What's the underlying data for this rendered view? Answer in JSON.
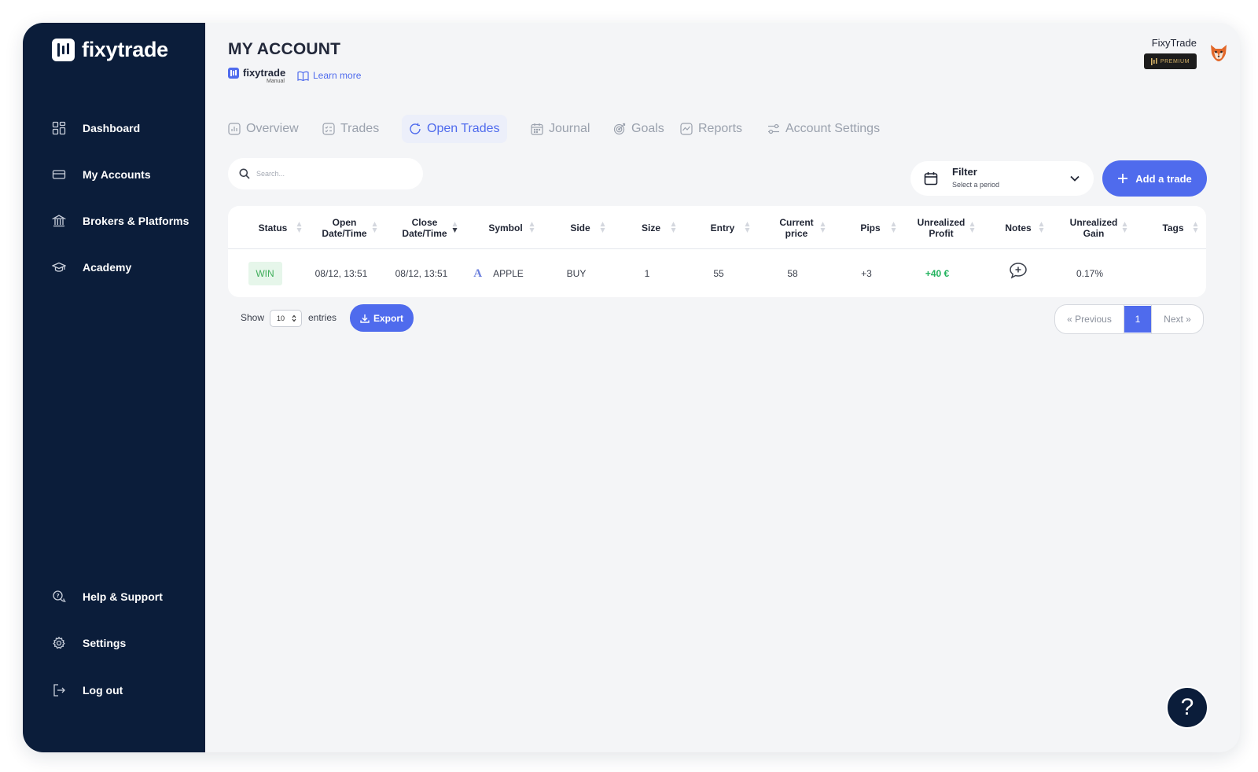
{
  "brand": {
    "name": "fixytrade"
  },
  "sidebar": {
    "items": [
      {
        "label": "Dashboard",
        "icon": "grid-icon"
      },
      {
        "label": "My Accounts",
        "icon": "card-icon"
      },
      {
        "label": "Brokers & Platforms",
        "icon": "bank-icon"
      },
      {
        "label": "Academy",
        "icon": "graduation-cap-icon"
      }
    ],
    "bottom_items": [
      {
        "label": "Help & Support",
        "icon": "help-chat-icon"
      },
      {
        "label": "Settings",
        "icon": "gear-icon"
      },
      {
        "label": "Log out",
        "icon": "logout-icon"
      }
    ]
  },
  "header": {
    "title": "MY ACCOUNT",
    "manual_brand": "fixytrade",
    "manual_sub": "Manual",
    "learn_more": "Learn more",
    "user_name": "FixyTrade",
    "premium_label": "PREMIUM"
  },
  "tabs": [
    {
      "label": "Overview",
      "icon": "bar-chart-icon"
    },
    {
      "label": "Trades",
      "icon": "list-check-icon"
    },
    {
      "label": "Open Trades",
      "icon": "refresh-icon",
      "active": true
    },
    {
      "label": "Journal",
      "icon": "calendar-icon"
    },
    {
      "label": "Goals",
      "icon": "target-icon"
    },
    {
      "label": "Reports",
      "icon": "report-icon"
    },
    {
      "label": "Account Settings",
      "icon": "sliders-icon"
    }
  ],
  "toolbar": {
    "search_placeholder": "Search...",
    "filter_title": "Filter",
    "filter_sub": "Select a period",
    "add_trade": "Add a trade"
  },
  "table": {
    "headers": {
      "status": "Status",
      "open_1": "Open",
      "open_2": "Date/Time",
      "close_1": "Close",
      "close_2": "Date/Time",
      "symbol": "Symbol",
      "side": "Side",
      "size": "Size",
      "entry": "Entry",
      "current_1": "Current",
      "current_2": "price",
      "pips": "Pips",
      "uprofit_1": "Unrealized",
      "uprofit_2": "Profit",
      "notes": "Notes",
      "ugain_1": "Unrealized",
      "ugain_2": "Gain",
      "tags": "Tags"
    },
    "rows": [
      {
        "status": "WIN",
        "open": "08/12, 13:51",
        "close": "08/12, 13:51",
        "symbol_logo": "A",
        "symbol": "APPLE",
        "side": "BUY",
        "size": "1",
        "entry": "55",
        "current": "58",
        "pips": "+3",
        "profit": "+40 €",
        "gain": "0.17%",
        "tags": ""
      }
    ]
  },
  "footer": {
    "show": "Show",
    "entries_value": "10",
    "entries": "entries",
    "export": "Export",
    "prev": "« Previous",
    "page": "1",
    "next": "Next »"
  },
  "help_fab": "?",
  "colors": {
    "sidebar_bg": "#0b1d3a",
    "accent": "#4f6bed",
    "win_bg": "#e6f6ea",
    "win_text": "#3fae5a",
    "profit": "#22b35e"
  }
}
